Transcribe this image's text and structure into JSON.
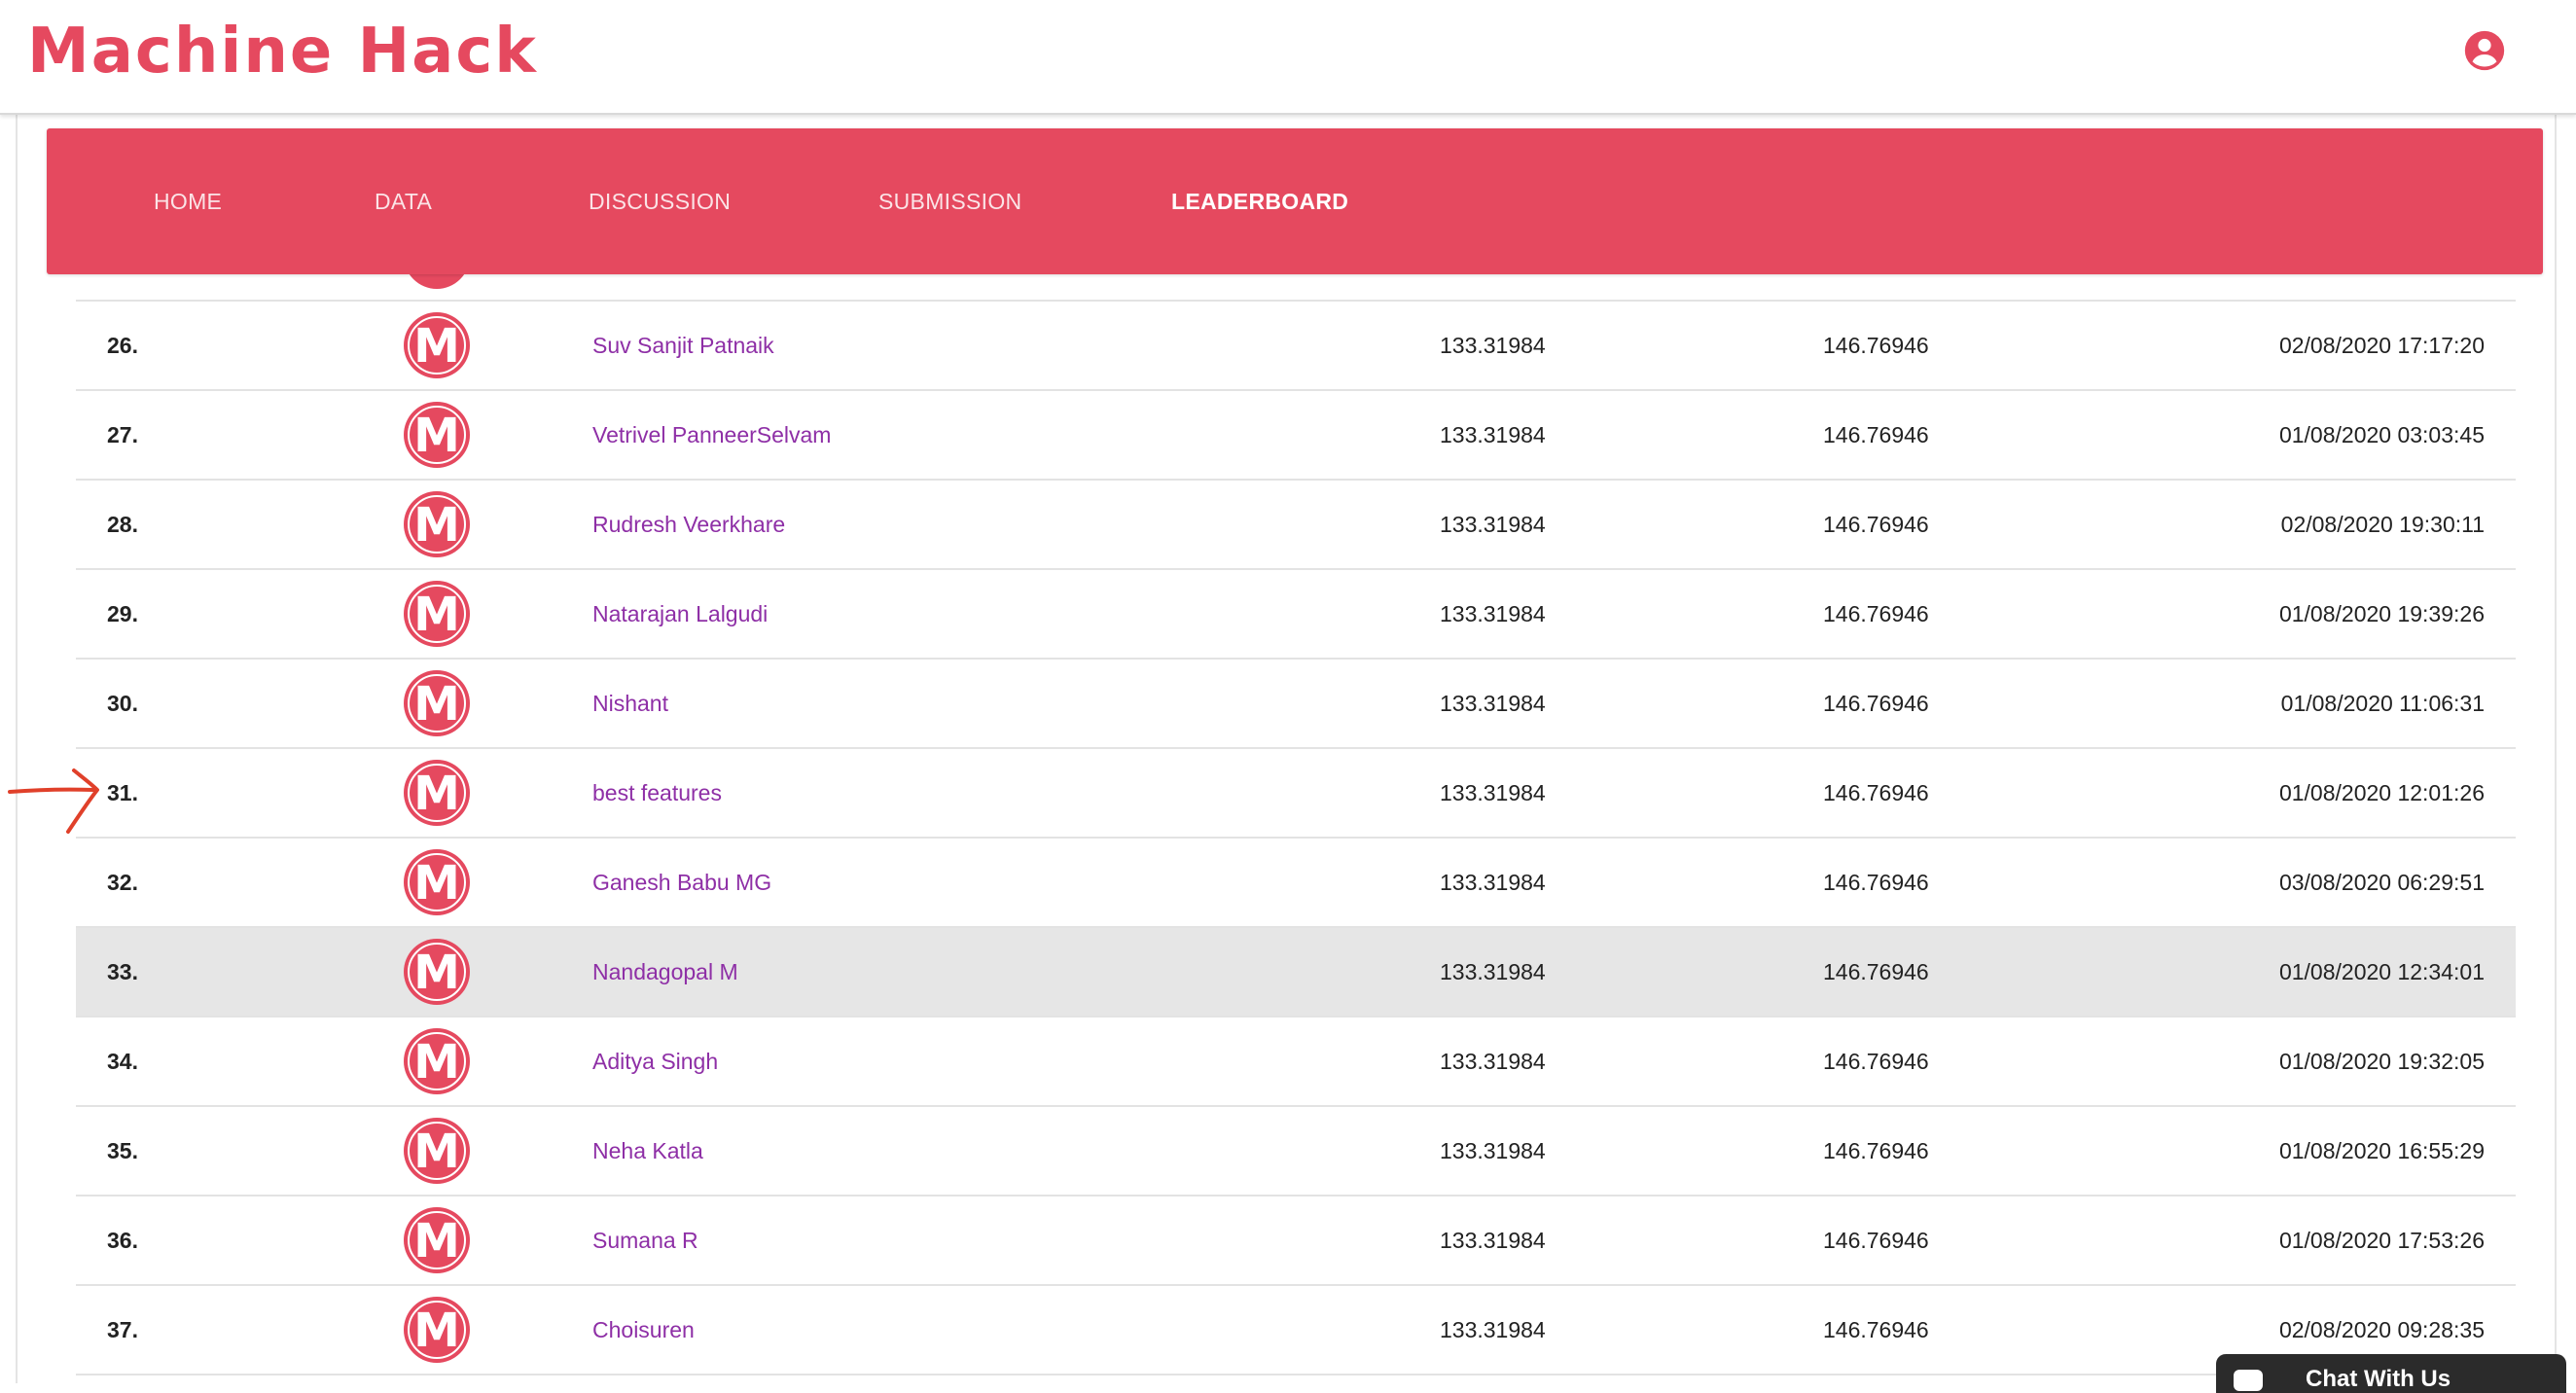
{
  "brand": {
    "logo_text": "Machine Hack",
    "accent_color": "#e5495f",
    "name_link_color": "#8e2fa6"
  },
  "header": {
    "account_icon": "account-circle-icon"
  },
  "nav": {
    "items": [
      {
        "label": "HOME",
        "active": false
      },
      {
        "label": "DATA",
        "active": false
      },
      {
        "label": "DISCUSSION",
        "active": false
      },
      {
        "label": "SUBMISSION",
        "active": false
      },
      {
        "label": "LEADERBOARD",
        "active": true
      }
    ]
  },
  "leaderboard": {
    "avatar_letter": "M",
    "rows": [
      {
        "rank": "26.",
        "name": "Suv Sanjit Patnaik",
        "score_public": "133.31984",
        "score_private": "146.76946",
        "date": "02/08/2020 17:17:20"
      },
      {
        "rank": "27.",
        "name": "Vetrivel PanneerSelvam",
        "score_public": "133.31984",
        "score_private": "146.76946",
        "date": "01/08/2020 03:03:45"
      },
      {
        "rank": "28.",
        "name": "Rudresh Veerkhare",
        "score_public": "133.31984",
        "score_private": "146.76946",
        "date": "02/08/2020 19:30:11"
      },
      {
        "rank": "29.",
        "name": "Natarajan Lalgudi",
        "score_public": "133.31984",
        "score_private": "146.76946",
        "date": "01/08/2020 19:39:26"
      },
      {
        "rank": "30.",
        "name": "Nishant",
        "score_public": "133.31984",
        "score_private": "146.76946",
        "date": "01/08/2020 11:06:31"
      },
      {
        "rank": "31.",
        "name": "best features",
        "score_public": "133.31984",
        "score_private": "146.76946",
        "date": "01/08/2020 12:01:26"
      },
      {
        "rank": "32.",
        "name": "Ganesh Babu MG",
        "score_public": "133.31984",
        "score_private": "146.76946",
        "date": "03/08/2020 06:29:51"
      },
      {
        "rank": "33.",
        "name": "Nandagopal M",
        "score_public": "133.31984",
        "score_private": "146.76946",
        "date": "01/08/2020 12:34:01",
        "highlighted": true
      },
      {
        "rank": "34.",
        "name": "Aditya Singh",
        "score_public": "133.31984",
        "score_private": "146.76946",
        "date": "01/08/2020 19:32:05"
      },
      {
        "rank": "35.",
        "name": "Neha Katla",
        "score_public": "133.31984",
        "score_private": "146.76946",
        "date": "01/08/2020 16:55:29"
      },
      {
        "rank": "36.",
        "name": "Sumana R",
        "score_public": "133.31984",
        "score_private": "146.76946",
        "date": "01/08/2020 17:53:26"
      },
      {
        "rank": "37.",
        "name": "Choisuren",
        "score_public": "133.31984",
        "score_private": "146.76946",
        "date": "02/08/2020 09:28:35"
      }
    ]
  },
  "annotation": {
    "icon": "red-arrow-icon",
    "color": "#e0402a"
  },
  "chat": {
    "label": "Chat With Us",
    "icon": "chat-bubble-icon"
  }
}
